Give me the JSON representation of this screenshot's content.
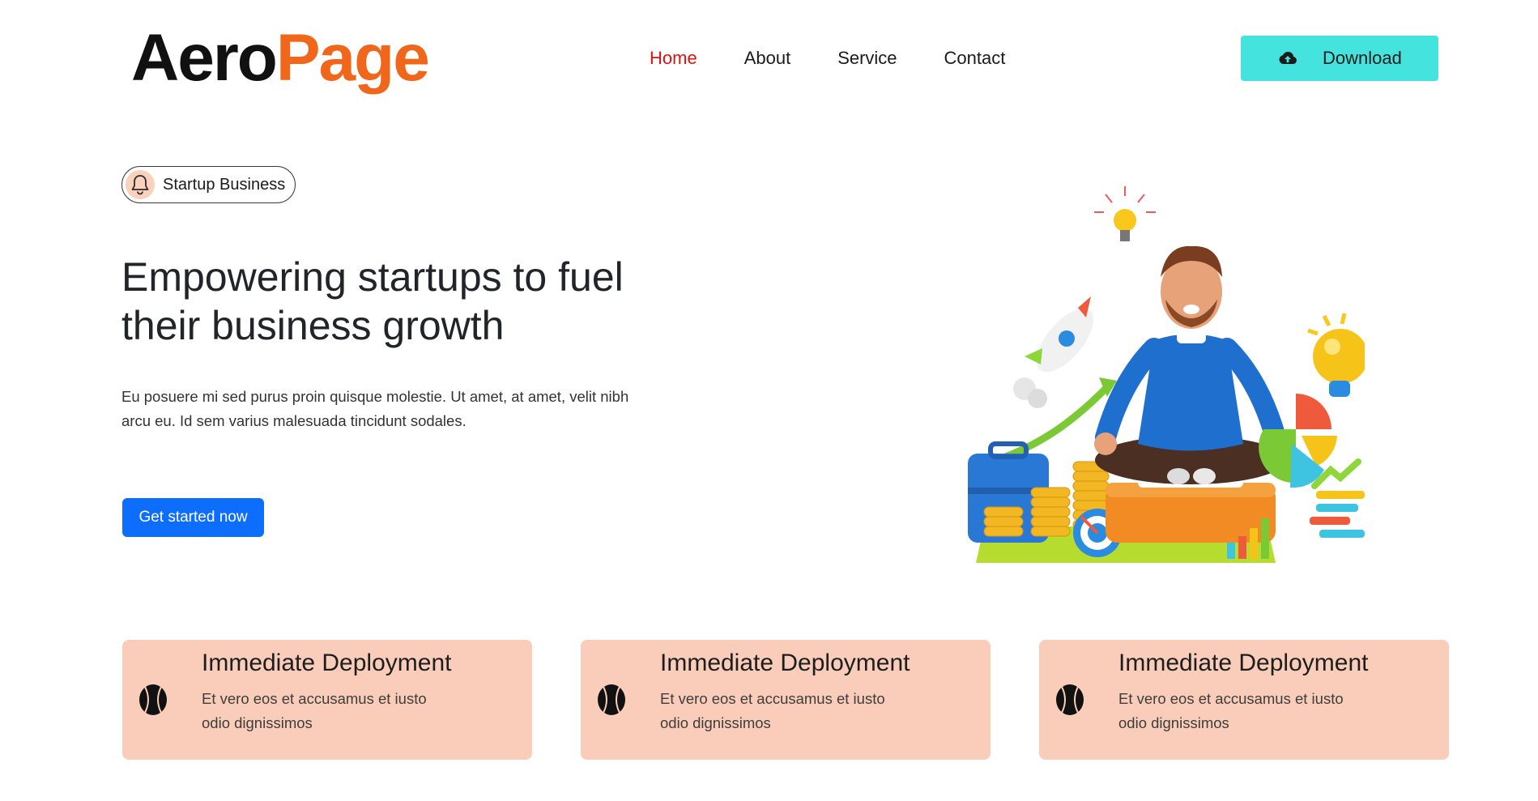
{
  "header": {
    "logo": {
      "part1": "Aero",
      "part2": "Page"
    },
    "nav": [
      {
        "label": "Home",
        "active": true
      },
      {
        "label": "About",
        "active": false
      },
      {
        "label": "Service",
        "active": false
      },
      {
        "label": "Contact",
        "active": false
      }
    ],
    "download_label": "Download",
    "download_icon": "cloud-upload-icon"
  },
  "hero": {
    "badge": {
      "icon": "bell-icon",
      "text": "Startup Business"
    },
    "title": "Empowering startups to fuel their business growth",
    "description": "Eu posuere mi sed purus proin quisque molestie. Ut amet, at amet, velit nibh arcu eu. Id sem varius malesuada tincidunt sodales.",
    "cta_label": "Get started now",
    "illustration": "meditating-businessman-illustration"
  },
  "features": [
    {
      "icon": "tennis-ball-icon",
      "title": "Immediate Deployment",
      "description": "Et vero eos et accusamus et iusto odio dignissimos"
    },
    {
      "icon": "tennis-ball-icon",
      "title": "Immediate Deployment",
      "description": "Et vero eos et accusamus et iusto odio dignissimos"
    },
    {
      "icon": "tennis-ball-icon",
      "title": "Immediate Deployment",
      "description": "Et vero eos et accusamus et iusto odio dignissimos"
    }
  ],
  "colors": {
    "brand_orange": "#f0661a",
    "nav_active": "#e01010",
    "download_bg": "#45e3dd",
    "cta_bg": "#0d6efd",
    "card_bg": "#f9cdb9",
    "badge_icon_bg": "#fad1bd"
  }
}
